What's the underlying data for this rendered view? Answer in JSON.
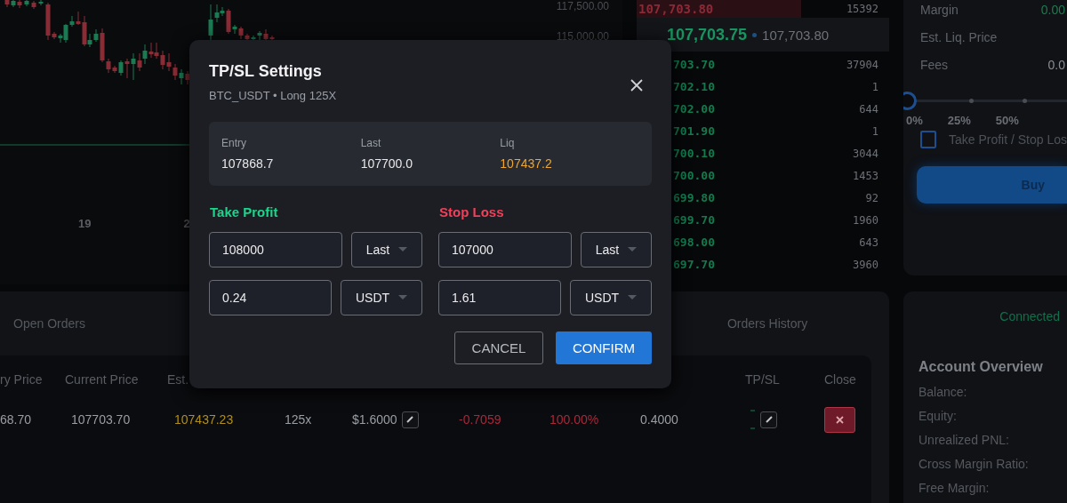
{
  "chart": {
    "price_labels": [
      "117,500.00",
      "115,000.00"
    ],
    "date_labels": [
      "19",
      "2"
    ]
  },
  "order_book": {
    "asks": [
      {
        "price": "107,703.80",
        "qty": "15392"
      }
    ],
    "mid": {
      "price": "107,703.75",
      "mark": "107,703.80"
    },
    "bids": [
      {
        "price": "703.70",
        "qty": "37904"
      },
      {
        "price": "702.10",
        "qty": "1"
      },
      {
        "price": "702.00",
        "qty": "644"
      },
      {
        "price": "701.90",
        "qty": "1"
      },
      {
        "price": "700.10",
        "qty": "3044"
      },
      {
        "price": "700.00",
        "qty": "1453"
      },
      {
        "price": "699.80",
        "qty": "92"
      },
      {
        "price": "699.70",
        "qty": "1960"
      },
      {
        "price": "698.00",
        "qty": "643"
      },
      {
        "price": "697.70",
        "qty": "3960"
      }
    ]
  },
  "order_form": {
    "rows": [
      {
        "label": "Margin",
        "value": "0.00",
        "color": "#1f7a4f"
      },
      {
        "label": "Est. Liq. Price"
      },
      {
        "label": "Fees",
        "value": "0.0",
        "color": "#8a8e94"
      }
    ],
    "slider": {
      "level": 0,
      "ticks": [
        "0%",
        "25%",
        "50%"
      ]
    },
    "checkbox": {
      "label": "Take Profit / Stop Los",
      "checked": false
    },
    "buy_button": "Buy"
  },
  "positions": {
    "tabs": [
      "Open Orders",
      "Orders History"
    ],
    "columns": [
      "ry Price",
      "Current Price",
      "Est.",
      "TP/SL",
      "Close"
    ],
    "row": [
      {
        "kind": "plain",
        "text": "68.70"
      },
      {
        "kind": "plain",
        "text": "107703.70"
      },
      {
        "kind": "warn",
        "text": "107437.23"
      },
      {
        "kind": "plain",
        "text": "125x"
      },
      {
        "kind": "edit",
        "text": "$1.6000"
      },
      {
        "kind": "loss",
        "text": "-0.7059"
      },
      {
        "kind": "loss",
        "text": "100.00%"
      },
      {
        "kind": "plain",
        "text": "0.4000"
      },
      {
        "kind": "tpsl"
      },
      {
        "kind": "close"
      }
    ]
  },
  "account": {
    "status": "Connected",
    "title": "Account Overview",
    "rows": [
      "Balance:",
      "Equity:",
      "Unrealized PNL:",
      "Cross Margin Ratio:",
      "Free Margin:"
    ]
  },
  "modal": {
    "title": "TP/SL Settings",
    "subtitle": "BTC_USDT • Long 125X",
    "stats": [
      {
        "label": "Entry",
        "value": "107868.7",
        "color": "#e8e8ea"
      },
      {
        "label": "Last",
        "value": "107700.0",
        "color": "#e8e8ea"
      },
      {
        "label": "Liq",
        "value": "107437.2",
        "color": "#f0a52e"
      }
    ],
    "sections": [
      {
        "kind": "profit",
        "title": "Take Profit",
        "price": "108000",
        "trigger": "Last",
        "amount": "0.24",
        "unit": "USDT"
      },
      {
        "kind": "loss",
        "title": "Stop Loss",
        "price": "107000",
        "trigger": "Last",
        "amount": "1.61",
        "unit": "USDT"
      }
    ],
    "buttons": [
      {
        "kind": "secondary",
        "label": "CANCEL"
      },
      {
        "kind": "primary",
        "label": "CONFIRM"
      }
    ]
  }
}
